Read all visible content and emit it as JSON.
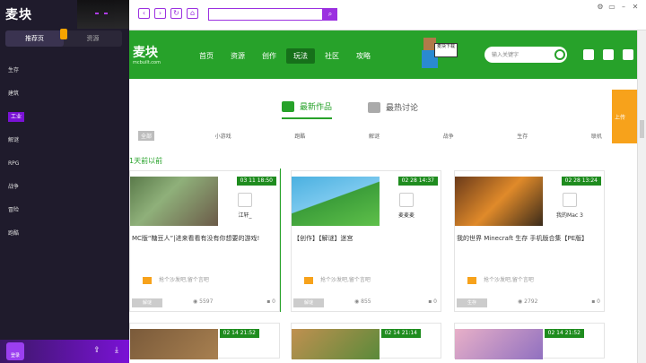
{
  "sidebar": {
    "logo": "麦块",
    "tabs": [
      "推荐页",
      "资源"
    ],
    "items": [
      "生存",
      "建筑",
      "工业",
      "解谜",
      "RPG",
      "战争",
      "冒险",
      "跑酷"
    ],
    "active": "工业",
    "login": "登录"
  },
  "browser": {
    "address": ""
  },
  "header": {
    "brand": "麦块",
    "brand_sub": "mcbuilt.com",
    "menu": [
      "首页",
      "资源",
      "创作",
      "玩法",
      "社区",
      "攻略"
    ],
    "active_menu": "玩法",
    "sign_text": "麦块下载",
    "search_placeholder": "输入关键字"
  },
  "orange_label": "上传",
  "feed": {
    "tabs": [
      "最新作品",
      "最热讨论"
    ],
    "categories": [
      "全部",
      "小游戏",
      "跑酷",
      "解谜",
      "战争",
      "生存",
      "联机"
    ],
    "section_label": "1天前以前"
  },
  "cards": [
    {
      "time": "03 11 18:50",
      "author": "江轩_",
      "title": "MC版“糖豆人”|进来看看有没有你想要的游戏!",
      "comment": "抢个沙发吧,留个言吧",
      "tag": "解谜",
      "views": "5597",
      "count": "0"
    },
    {
      "time": "02 28 14:37",
      "author": "麦麦麦",
      "title": "【创作】【解谜】迷宫",
      "comment": "抢个沙发吧,留个言吧",
      "tag": "解谜",
      "views": "855",
      "count": "0"
    },
    {
      "time": "02 28 13:24",
      "author": "我的Mac 3",
      "title": "我的世界 Minecraft 生存 手机版合集【PE版】",
      "comment": "抢个沙发吧,留个言吧",
      "tag": "生存",
      "views": "2792",
      "count": "0"
    }
  ],
  "cards_row2": [
    {
      "time": "02 14 21:52"
    },
    {
      "time": "02 14 21:14"
    },
    {
      "time": "02 14 21:52"
    }
  ],
  "colors": {
    "brand": "#27a22a",
    "sidebar": "#1f1b2c",
    "accent": "#9b30e0",
    "orange": "#f7a21b"
  }
}
